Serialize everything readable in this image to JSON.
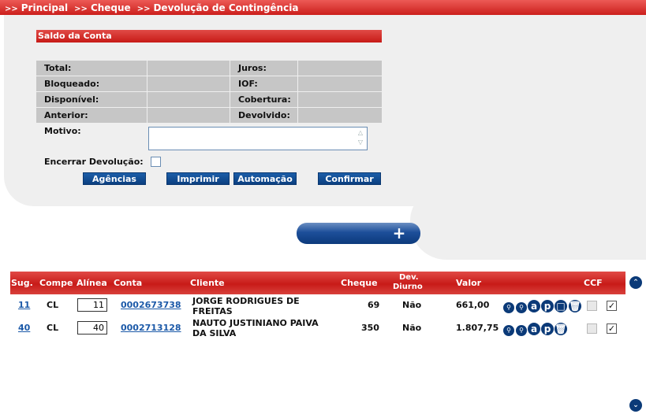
{
  "breadcrumb": [
    {
      "chevron": ">>",
      "label": "Principal"
    },
    {
      "chevron": ">>",
      "label": "Cheque"
    },
    {
      "chevron": ">>",
      "label": "Devolução de Contingência"
    }
  ],
  "saldo": {
    "title": "Saldo da Conta",
    "left_labels": [
      "Total:",
      "Bloqueado:",
      "Disponível:",
      "Anterior:"
    ],
    "right_labels": [
      "Juros:",
      "IOF:",
      "Cobertura:",
      "Devolvido:"
    ]
  },
  "form": {
    "motivo_label": "Motivo:",
    "motivo_value": "",
    "encerrar_label": "Encerrar Devolução:",
    "encerrar_checked": false
  },
  "buttons": {
    "agencias": "Agências",
    "imprimir": "Imprimir",
    "automacao": "Automação",
    "confirmar": "Confirmar",
    "add": "+"
  },
  "table": {
    "headers": {
      "sug": "Sug.",
      "compe": "Compe",
      "alinea": "Alínea",
      "conta": "Conta",
      "cliente": "Cliente",
      "cheque": "Cheque",
      "dev_diurno_1": "Dev.",
      "dev_diurno_2": "Diurno",
      "valor": "Valor",
      "ccf": "CCF"
    },
    "rows": [
      {
        "sug": "11",
        "compe": "CL",
        "alinea": "11",
        "conta": "0002673738",
        "cliente_1": "JORGE RODRIGUES DE",
        "cliente_2": "FREITAS",
        "cheque": "69",
        "dev_diurno": "Não",
        "valor": "661,00",
        "ccf_checked": false,
        "selected": true,
        "actions": [
          "zoom-icon",
          "zoom-icon",
          "a-icon",
          "p-icon",
          "square-icon",
          "trash-icon"
        ]
      },
      {
        "sug": "40",
        "compe": "CL",
        "alinea": "40",
        "conta": "0002713128",
        "cliente_1": "NAUTO JUSTINIANO PAIVA",
        "cliente_2": "DA SILVA",
        "cheque": "350",
        "dev_diurno": "Não",
        "valor": "1.807,75",
        "ccf_checked": false,
        "selected": true,
        "actions": [
          "zoom-icon",
          "zoom-icon",
          "a-icon",
          "p-icon",
          "trash-icon"
        ]
      }
    ]
  },
  "icons": {
    "scroll_up": "double-chevron-up-icon",
    "scroll_down": "double-chevron-down-icon"
  },
  "colors": {
    "header_red": "#cc1f1c",
    "button_blue": "#0b3f80",
    "link_blue": "#1b59a8",
    "panel_grey": "#efefef"
  }
}
